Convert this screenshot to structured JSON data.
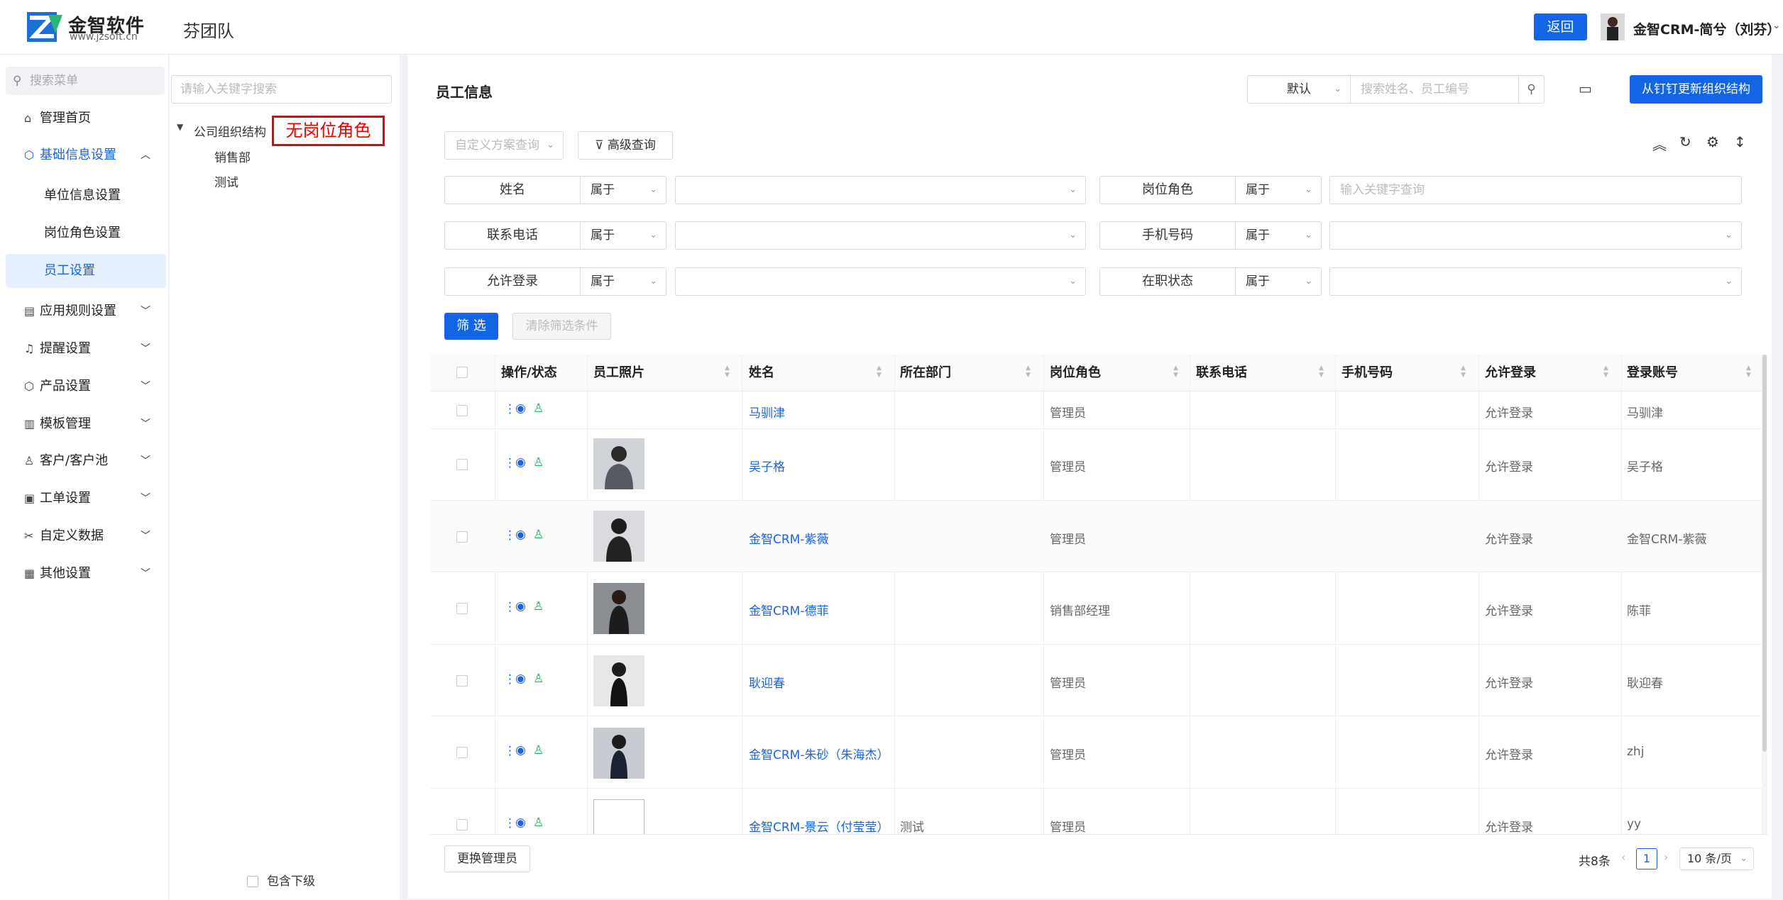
{
  "header": {
    "logo_title": "金智软件",
    "logo_subtitle": "www.jzsoft.cn",
    "team_name": "芬团队",
    "back_label": "返回",
    "user_name": "金智CRM-简兮（刘芬）"
  },
  "sidebar": {
    "search_placeholder": "搜索菜单",
    "items": [
      {
        "label": "管理首页",
        "icon": "home-icon"
      },
      {
        "label": "基础信息设置",
        "icon": "cube-icon",
        "expanded": true
      },
      {
        "label": "应用规则设置",
        "icon": "doc-icon"
      },
      {
        "label": "提醒设置",
        "icon": "bell-icon"
      },
      {
        "label": "产品设置",
        "icon": "box-icon"
      },
      {
        "label": "模板管理",
        "icon": "template-icon"
      },
      {
        "label": "客户/客户池",
        "icon": "user-icon"
      },
      {
        "label": "工单设置",
        "icon": "order-icon"
      },
      {
        "label": "自定义数据",
        "icon": "tools-icon"
      },
      {
        "label": "其他设置",
        "icon": "grid-icon"
      }
    ],
    "sub_items": [
      "单位信息设置",
      "岗位角色设置",
      "员工设置"
    ]
  },
  "tree": {
    "search_placeholder": "请输入关键字搜索",
    "root": "公司组织结构",
    "children": [
      "销售部",
      "测试"
    ],
    "annotation": "无岗位角色",
    "include_sub_label": "包含下级"
  },
  "main": {
    "title": "员工信息",
    "view_select": "默认",
    "search_placeholder": "搜索姓名、员工编号",
    "sync_button": "从钉钉更新组织结构",
    "custom_scheme_placeholder": "自定义方案查询",
    "advanced_query": "高级查询",
    "filters": [
      {
        "label": "姓名",
        "op": "属于",
        "value": ""
      },
      {
        "label": "岗位角色",
        "op": "属于",
        "value": "",
        "placeholder": "输入关键字查询"
      },
      {
        "label": "联系电话",
        "op": "属于",
        "value": ""
      },
      {
        "label": "手机号码",
        "op": "属于",
        "value": ""
      },
      {
        "label": "允许登录",
        "op": "属于",
        "value": ""
      },
      {
        "label": "在职状态",
        "op": "属于",
        "value": ""
      }
    ],
    "filter_button": "筛 选",
    "clear_button": "清除筛选条件",
    "columns": [
      "操作/状态",
      "员工照片",
      "姓名",
      "所在部门",
      "岗位角色",
      "联系电话",
      "手机号码",
      "允许登录",
      "登录账号"
    ],
    "rows": [
      {
        "name": "马驯津",
        "dept": "",
        "role": "管理员",
        "phone": "",
        "mobile": "",
        "login": "允许登录",
        "account": "马驯津",
        "photo": false
      },
      {
        "name": "吴子格",
        "dept": "",
        "role": "管理员",
        "phone": "",
        "mobile": "",
        "login": "允许登录",
        "account": "吴子格",
        "photo": true
      },
      {
        "name": "金智CRM-紫薇",
        "dept": "",
        "role": "管理员",
        "phone": "",
        "mobile": "",
        "login": "允许登录",
        "account": "金智CRM-紫薇",
        "photo": true
      },
      {
        "name": "金智CRM-德菲",
        "dept": "",
        "role": "销售部经理",
        "phone": "",
        "mobile": "",
        "login": "允许登录",
        "account": "陈菲",
        "photo": true
      },
      {
        "name": "耿迎春",
        "dept": "",
        "role": "管理员",
        "phone": "",
        "mobile": "",
        "login": "允许登录",
        "account": "耿迎春",
        "photo": true
      },
      {
        "name": "金智CRM-朱砂（朱海杰）",
        "dept": "",
        "role": "管理员",
        "phone": "",
        "mobile": "",
        "login": "允许登录",
        "account": "zhj",
        "photo": true
      },
      {
        "name": "金智CRM-景云（付莹莹）",
        "dept": "测试",
        "role": "管理员",
        "phone": "",
        "mobile": "",
        "login": "允许登录",
        "account": "yy",
        "photo": "broken"
      }
    ],
    "change_admin": "更换管理员",
    "total": "共8条",
    "current_page": "1",
    "page_size": "10 条/页"
  },
  "colors": {
    "primary": "#1464e6",
    "link": "#1a63e0",
    "annotation": "#e00000"
  }
}
